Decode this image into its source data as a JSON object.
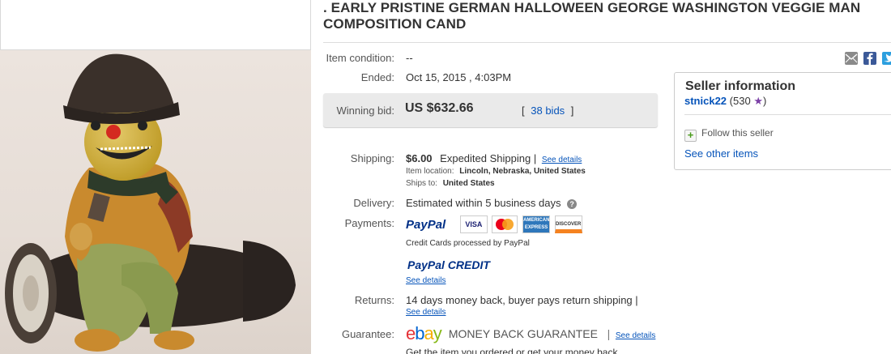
{
  "listing": {
    "title_line1": ". EARLY PRISTINE GERMAN HALLOWEEN GEORGE WASHINGTON VEGGIE MAN",
    "title_line2": "COMPOSITION CAND"
  },
  "details": {
    "condition_label": "Item condition:",
    "condition_value": "--",
    "ended_label": "Ended:",
    "ended_value": "Oct 15, 2015 , 4:03PM",
    "winning_label": "Winning bid:",
    "winning_value": "US $632.66",
    "bids_open": "[",
    "bids_link": "38 bids",
    "bids_close": "]",
    "shipping_label": "Shipping:",
    "shipping_price": "$6.00",
    "shipping_method": "Expedited Shipping |",
    "shipping_details": "See details",
    "item_location_label": "Item location:",
    "item_location_value": "Lincoln, Nebraska, United States",
    "ships_to_label": "Ships to:",
    "ships_to_value": "United States",
    "delivery_label": "Delivery:",
    "delivery_value": "Estimated within 5 business days",
    "payments_label": "Payments:",
    "paypal": "PayPal",
    "cards": [
      "VISA",
      "MasterCard",
      "AMERICAN EXPRESS",
      "DISCOVER"
    ],
    "credit_note": "Credit Cards processed by PayPal",
    "paypal_credit": "PayPal CREDIT",
    "paypal_credit_details": "See details",
    "returns_label": "Returns:",
    "returns_value": "14 days money back, buyer pays return shipping |",
    "returns_details": "See details",
    "guarantee_label": "Guarantee:",
    "guarantee_brand_e": "e",
    "guarantee_brand_b": "b",
    "guarantee_brand_a": "a",
    "guarantee_brand_y": "y",
    "guarantee_text": "MONEY BACK GUARANTEE",
    "guarantee_sep": "|",
    "guarantee_details": "See details",
    "guarantee_note": "Get the item you ordered or get your money back"
  },
  "seller": {
    "title": "Seller information",
    "username": "stnick22",
    "feedback": "(530",
    "feedback_close": ")",
    "follow": "Follow this seller",
    "other_items": "See other items"
  },
  "help_icon": "?",
  "icons": [
    "email-icon",
    "facebook-icon",
    "twitter-icon",
    "star-icon",
    "plus-icon",
    "help-icon"
  ],
  "colors": {
    "link": "#0654ba",
    "paypal_blue": "#003087",
    "paypal_light": "#009cde",
    "star": "#7b3fa6",
    "ebay_red": "#e53238",
    "ebay_blue": "#0064d2",
    "ebay_yellow": "#f5af02",
    "ebay_green": "#86b817"
  }
}
